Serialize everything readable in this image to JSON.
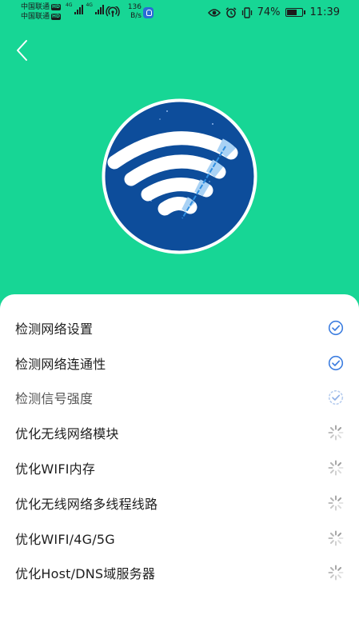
{
  "status_bar": {
    "carrier_1": "中国联通",
    "carrier_2": "中国联通",
    "hd_badge": "HD",
    "net_type_1": "4G",
    "net_type_2": "4G",
    "net_speed_value": "136",
    "net_speed_unit": "B/s",
    "battery_percent": "74%",
    "battery_level": 0.74,
    "time": "11:39"
  },
  "theme": {
    "background": "#17d695",
    "card": "#ffffff",
    "hero_circle": "#0d4d9b",
    "check_color": "#3d7ee0",
    "spinner_color": "#9a9a9a"
  },
  "tasks": [
    {
      "label": "检测网络设置",
      "status": "done",
      "icon": "check-circle-icon"
    },
    {
      "label": "检测网络连通性",
      "status": "done",
      "icon": "check-circle-icon"
    },
    {
      "label": "检测信号强度",
      "status": "scanning",
      "icon": "check-circle-pending-icon"
    },
    {
      "label": "优化无线网络模块",
      "status": "waiting",
      "icon": "spinner-icon"
    },
    {
      "label": "优化WIFI内存",
      "status": "waiting",
      "icon": "spinner-icon"
    },
    {
      "label": "优化无线网络多线程线路",
      "status": "waiting",
      "icon": "spinner-icon"
    },
    {
      "label": "优化WIFI/4G/5G",
      "status": "waiting",
      "icon": "spinner-icon"
    },
    {
      "label": "优化Host/DNS域服务器",
      "status": "waiting",
      "icon": "spinner-icon"
    }
  ]
}
